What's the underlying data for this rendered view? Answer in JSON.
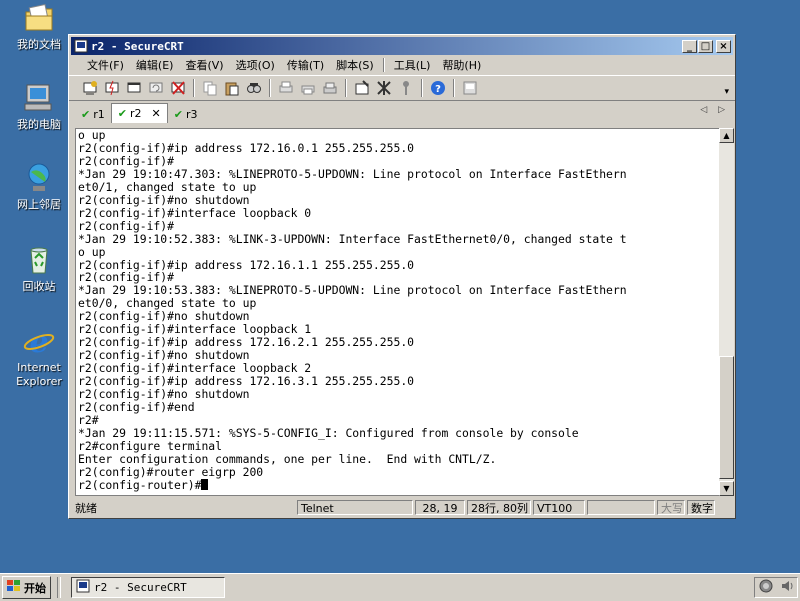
{
  "desktop": {
    "icons": [
      {
        "label": "我的文档",
        "icon": "my-documents-icon"
      },
      {
        "label": "我的电脑",
        "icon": "my-computer-icon"
      },
      {
        "label": "网上邻居",
        "icon": "network-places-icon"
      },
      {
        "label": "回收站",
        "icon": "recycle-bin-icon"
      },
      {
        "label": "Internet Explorer",
        "icon": "internet-explorer-icon"
      }
    ]
  },
  "window": {
    "title": "r2 - SecureCRT",
    "controls": {
      "minimize": "_",
      "maximize": "□",
      "close": "×"
    }
  },
  "menu": [
    "文件(F)",
    "编辑(E)",
    "查看(V)",
    "选项(O)",
    "传输(T)",
    "脚本(S)",
    "工具(L)",
    "帮助(H)"
  ],
  "tabs": [
    {
      "label": "r1",
      "active": false
    },
    {
      "label": "r2",
      "active": true
    },
    {
      "label": "r3",
      "active": false
    }
  ],
  "terminal": {
    "lines": [
      "o up",
      "r2(config-if)#ip address 172.16.0.1 255.255.255.0",
      "r2(config-if)#",
      "*Jan 29 19:10:47.303: %LINEPROTO-5-UPDOWN: Line protocol on Interface FastEthern",
      "et0/1, changed state to up",
      "r2(config-if)#no shutdown",
      "r2(config-if)#interface loopback 0",
      "r2(config-if)#",
      "*Jan 29 19:10:52.383: %LINK-3-UPDOWN: Interface FastEthernet0/0, changed state t",
      "o up",
      "r2(config-if)#ip address 172.16.1.1 255.255.255.0",
      "r2(config-if)#",
      "*Jan 29 19:10:53.383: %LINEPROTO-5-UPDOWN: Line protocol on Interface FastEthern",
      "et0/0, changed state to up",
      "r2(config-if)#no shutdown",
      "r2(config-if)#interface loopback 1",
      "r2(config-if)#ip address 172.16.2.1 255.255.255.0",
      "r2(config-if)#no shutdown",
      "r2(config-if)#interface loopback 2",
      "r2(config-if)#ip address 172.16.3.1 255.255.255.0",
      "r2(config-if)#no shutdown",
      "r2(config-if)#end",
      "r2#",
      "*Jan 29 19:11:15.571: %SYS-5-CONFIG_I: Configured from console by console",
      "r2#configure terminal",
      "Enter configuration commands, one per line.  End with CNTL/Z.",
      "r2(config)#router eigrp 200"
    ],
    "prompt": "r2(config-router)#"
  },
  "status": {
    "ready": "就绪",
    "protocol": "Telnet",
    "cursor_pos": "28, 19",
    "dimensions": "28行, 80列",
    "emulation": "VT100",
    "caps": "大写",
    "num": "数字"
  },
  "taskbar": {
    "start": "开始",
    "task": "r2 - SecureCRT"
  }
}
